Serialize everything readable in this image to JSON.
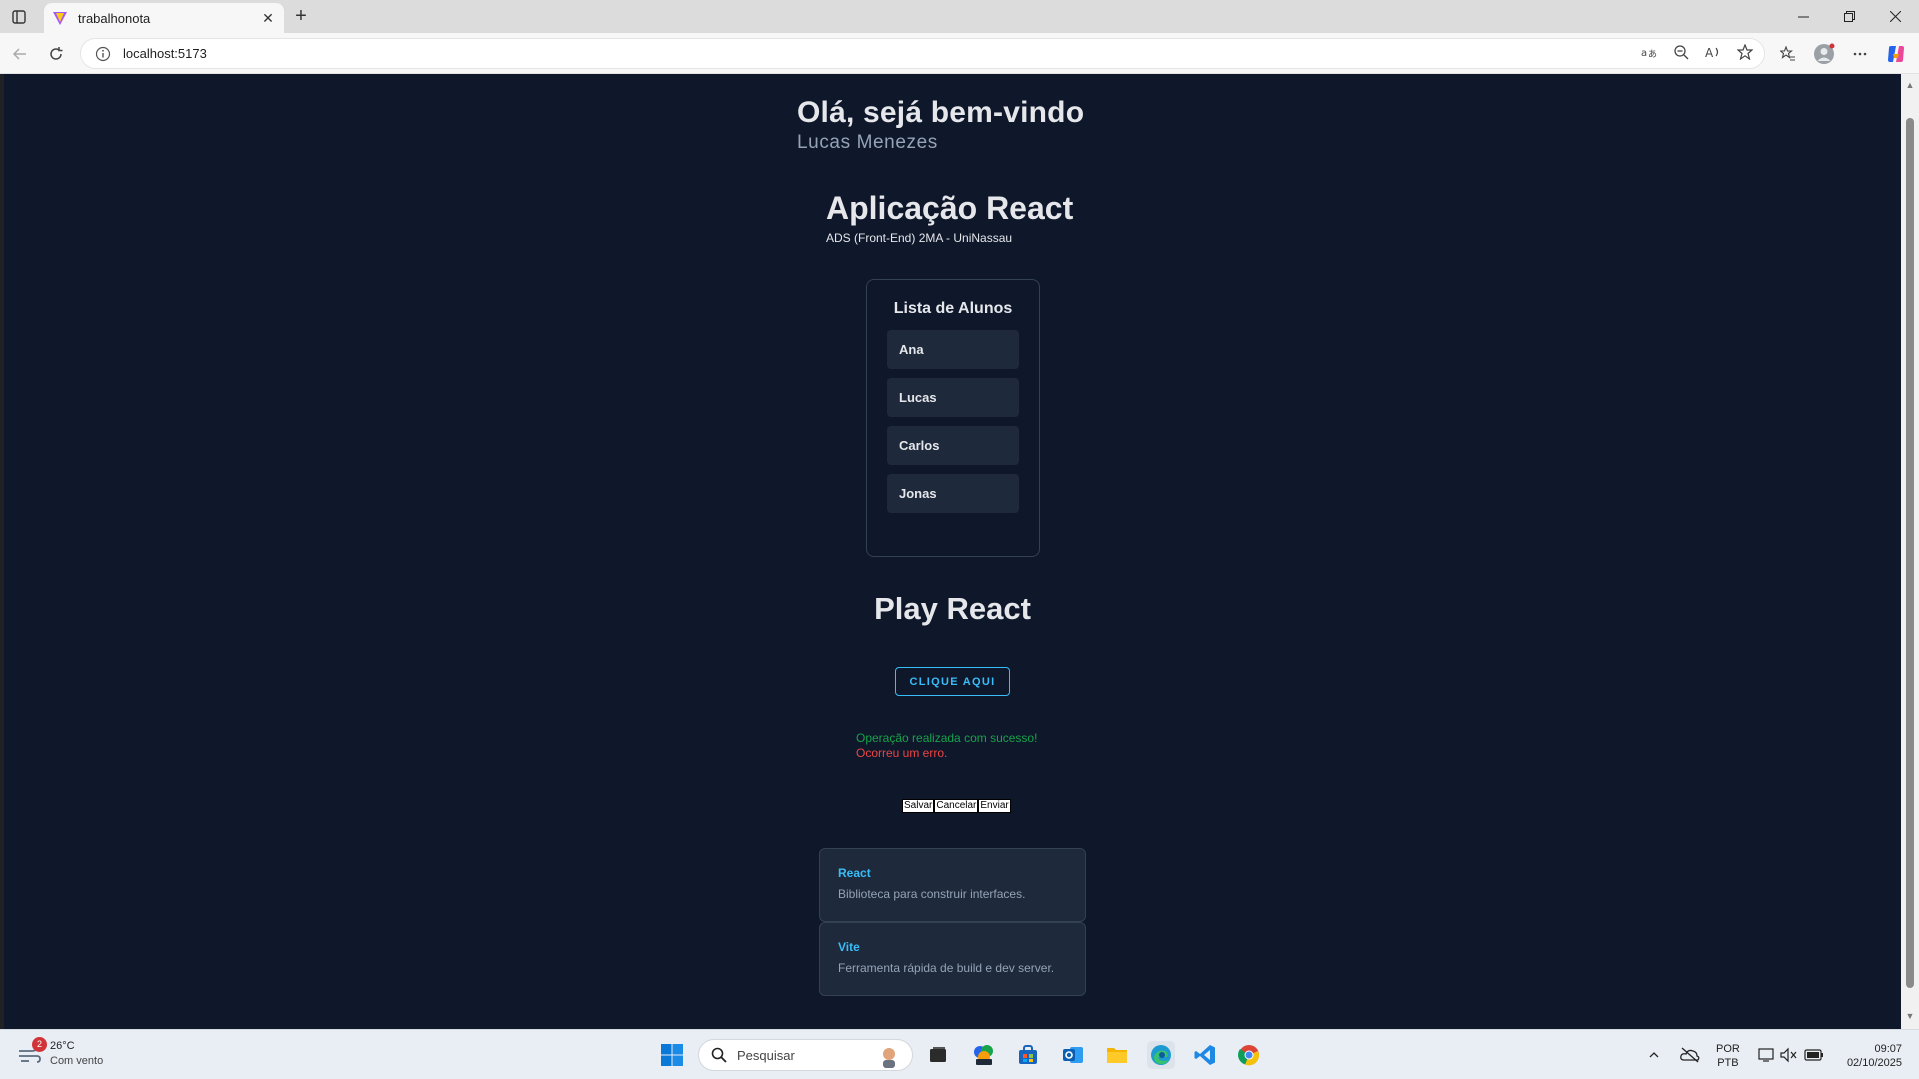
{
  "browser": {
    "tab_title": "trabalhonota",
    "url": "localhost:5173",
    "new_tab_symbol": "+",
    "tab_close_symbol": "✕"
  },
  "page": {
    "greeting": "Olá, sejá bem-vindo",
    "user_name": "Lucas Menezes",
    "app_title": "Aplicação React",
    "app_subtitle": "ADS (Front-End) 2MA - UniNassau",
    "list": {
      "title": "Lista de Alunos",
      "items": [
        "Ana",
        "Lucas",
        "Carlos",
        "Jonas"
      ]
    },
    "play_title": "Play React",
    "cta_label": "CLIQUE AQUI",
    "success_message": "Operação realizada com sucesso!",
    "error_message": "Ocorreu um erro.",
    "buttons": [
      "Salvar",
      "Cancelar",
      "Enviar"
    ],
    "cards": [
      {
        "title": "React",
        "description": "Biblioteca para construir interfaces."
      },
      {
        "title": "Vite",
        "description": "Ferramenta rápida de build e dev server."
      }
    ]
  },
  "taskbar": {
    "weather_badge": "2",
    "temperature": "26°C",
    "condition": "Com vento",
    "search_placeholder": "Pesquisar",
    "lang_top": "POR",
    "lang_bottom": "PTB",
    "time": "09:07",
    "date": "02/10/2025"
  },
  "colors": {
    "page_bg": "#0f172a",
    "card_bg": "#1e293b",
    "accent": "#38bdf8",
    "success": "#16a34a",
    "error": "#ef4444"
  }
}
